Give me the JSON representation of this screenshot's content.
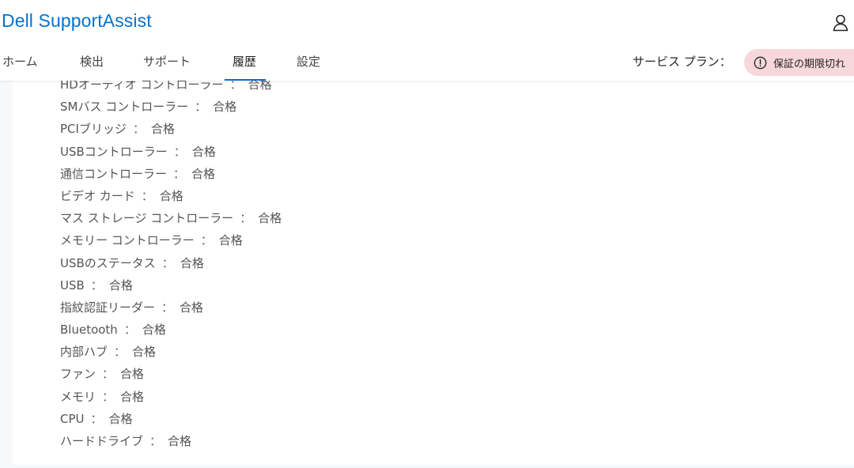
{
  "app": {
    "title": "Dell SupportAssist"
  },
  "header": {
    "account_icon": "user-icon"
  },
  "nav": {
    "tabs": [
      {
        "label": "ホーム",
        "active": false
      },
      {
        "label": "検出",
        "active": false
      },
      {
        "label": "サポート",
        "active": false
      },
      {
        "label": "履歴",
        "active": true
      },
      {
        "label": "設定",
        "active": false
      }
    ],
    "plan_label": "サービス プラン：",
    "warranty": {
      "icon": "alert-circle-icon",
      "text": "保証の期限切れ"
    }
  },
  "results": {
    "separator": "：",
    "items": [
      {
        "name": "HDオーディオ コントローラー",
        "status": "合格"
      },
      {
        "name": "SMバス コントローラー",
        "status": "合格"
      },
      {
        "name": "PCIブリッジ",
        "status": "合格"
      },
      {
        "name": "USBコントローラー",
        "status": "合格"
      },
      {
        "name": "通信コントローラー",
        "status": "合格"
      },
      {
        "name": "ビデオ カード",
        "status": "合格"
      },
      {
        "name": "マス ストレージ コントローラー",
        "status": "合格"
      },
      {
        "name": "メモリー コントローラー",
        "status": "合格"
      },
      {
        "name": "USBのステータス",
        "status": "合格"
      },
      {
        "name": "USB",
        "status": "合格"
      },
      {
        "name": "指紋認証リーダー",
        "status": "合格"
      },
      {
        "name": "Bluetooth",
        "status": "合格"
      },
      {
        "name": "内部ハブ",
        "status": "合格"
      },
      {
        "name": "ファン",
        "status": "合格"
      },
      {
        "name": "メモリ",
        "status": "合格"
      },
      {
        "name": "CPU",
        "status": "合格"
      },
      {
        "name": "ハードドライブ",
        "status": "合格"
      }
    ]
  },
  "colors": {
    "brand": "#0672cb",
    "warranty_badge_bg": "#f7d7da",
    "content_bg": "#f7f8fa"
  }
}
